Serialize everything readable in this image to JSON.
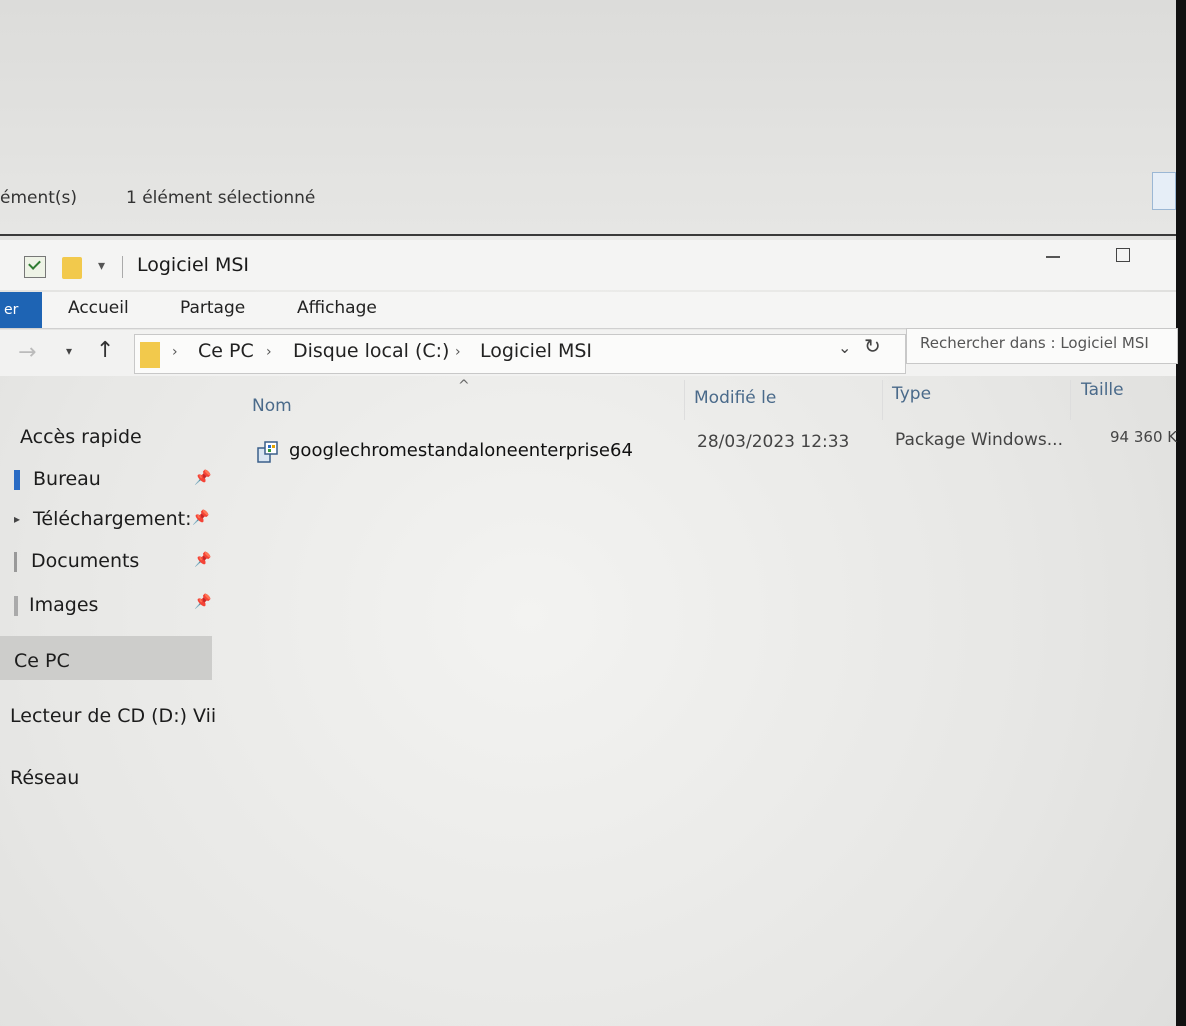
{
  "prev_window": {
    "status_left": "ément(s)",
    "status_right": "1 élément sélectionné"
  },
  "window": {
    "title": "Logiciel MSI",
    "qa_dropdown_glyph": "▾"
  },
  "ribbon": {
    "file_tab": "er",
    "tabs": [
      "Accueil",
      "Partage",
      "Affichage"
    ]
  },
  "address": {
    "crumbs": [
      "Ce PC",
      "Disque local (C:)",
      "Logiciel MSI"
    ],
    "separator": "›",
    "search_placeholder": "Rechercher dans : Logiciel MSI"
  },
  "sidebar": {
    "quick_access_label": "Accès rapide",
    "items": [
      {
        "label": "Bureau",
        "icon": "desktop-icon",
        "color": "#2b6cc4"
      },
      {
        "label": "Téléchargement:",
        "icon": "download-icon",
        "color": "#666666"
      },
      {
        "label": "Documents",
        "icon": "documents-icon",
        "color": "#888888"
      },
      {
        "label": "Images",
        "icon": "images-icon",
        "color": "#888888"
      }
    ],
    "this_pc": "Ce PC",
    "cd_drive": "Lecteur de CD (D:) Vii",
    "network": "Réseau"
  },
  "file_list": {
    "columns": [
      "Nom",
      "Modifié le",
      "Type",
      "Taille"
    ],
    "rows": [
      {
        "name": "googlechromestandaloneenterprise64",
        "modified": "28/03/2023 12:33",
        "type": "Package Windows...",
        "size": "94 360 K",
        "icon": "msi-package-icon"
      }
    ]
  },
  "colors": {
    "file_tab": "#1e64b4",
    "folder": "#f2c94c",
    "column_header": "#4a6a8a"
  }
}
